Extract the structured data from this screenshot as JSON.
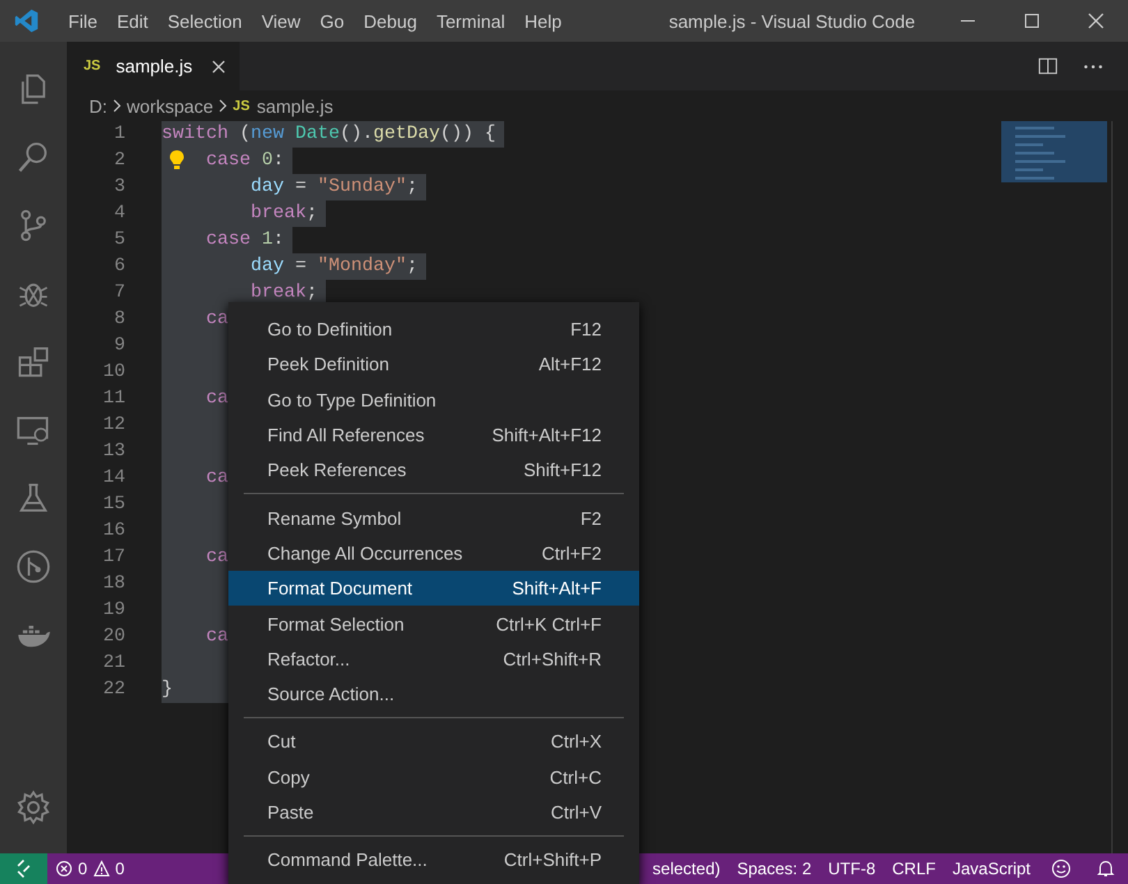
{
  "window": {
    "title": "sample.js - Visual Studio Code"
  },
  "menu_bar": [
    "File",
    "Edit",
    "Selection",
    "View",
    "Go",
    "Debug",
    "Terminal",
    "Help"
  ],
  "tabs": [
    {
      "badge": "JS",
      "label": "sample.js",
      "selected": true
    }
  ],
  "breadcrumb": [
    {
      "label": "D:"
    },
    {
      "label": "workspace"
    },
    {
      "badge": "JS",
      "label": "sample.js"
    }
  ],
  "code_lines": [
    {
      "number": "1",
      "selected": true,
      "tokens": [
        {
          "kind": "keyword",
          "text": "switch"
        },
        {
          "kind": "plain",
          "text": " ("
        },
        {
          "kind": "storage",
          "text": "new"
        },
        {
          "kind": "type",
          "text": " Date"
        },
        {
          "kind": "plain",
          "text": "()."
        },
        {
          "kind": "function",
          "text": "getDay"
        },
        {
          "kind": "plain",
          "text": "()) {"
        }
      ]
    },
    {
      "number": "2",
      "selected": true,
      "bulb": true,
      "tokens": [
        {
          "kind": "keyword",
          "text": "    case"
        },
        {
          "kind": "number",
          "text": " 0"
        },
        {
          "kind": "plain",
          "text": ":"
        }
      ]
    },
    {
      "number": "3",
      "selected": true,
      "tokens": [
        {
          "kind": "variable",
          "text": "        day"
        },
        {
          "kind": "plain",
          "text": " = "
        },
        {
          "kind": "string",
          "text": "\"Sunday\""
        },
        {
          "kind": "plain",
          "text": ";"
        }
      ]
    },
    {
      "number": "4",
      "selected": true,
      "tokens": [
        {
          "kind": "keyword",
          "text": "        break"
        },
        {
          "kind": "plain",
          "text": ";"
        }
      ]
    },
    {
      "number": "5",
      "selected": true,
      "tokens": [
        {
          "kind": "keyword",
          "text": "    case"
        },
        {
          "kind": "number",
          "text": " 1"
        },
        {
          "kind": "plain",
          "text": ":"
        }
      ]
    },
    {
      "number": "6",
      "selected": true,
      "tokens": [
        {
          "kind": "variable",
          "text": "        day"
        },
        {
          "kind": "plain",
          "text": " = "
        },
        {
          "kind": "string",
          "text": "\"Monday\""
        },
        {
          "kind": "plain",
          "text": ";"
        }
      ]
    },
    {
      "number": "7",
      "selected": true,
      "tokens": [
        {
          "kind": "keyword",
          "text": "        break"
        },
        {
          "kind": "plain",
          "text": ";"
        }
      ]
    },
    {
      "number": "8",
      "selected": true,
      "tokens": [
        {
          "kind": "keyword",
          "text": "    ca"
        }
      ]
    },
    {
      "number": "9",
      "selected": true
    },
    {
      "number": "10",
      "selected": true
    },
    {
      "number": "11",
      "selected": true,
      "tokens": [
        {
          "kind": "keyword",
          "text": "    ca"
        }
      ]
    },
    {
      "number": "12",
      "selected": true
    },
    {
      "number": "13",
      "selected": true
    },
    {
      "number": "14",
      "selected": true,
      "tokens": [
        {
          "kind": "keyword",
          "text": "    ca"
        }
      ]
    },
    {
      "number": "15",
      "selected": true
    },
    {
      "number": "16",
      "selected": true
    },
    {
      "number": "17",
      "selected": true,
      "tokens": [
        {
          "kind": "keyword",
          "text": "    ca"
        }
      ]
    },
    {
      "number": "18",
      "selected": true
    },
    {
      "number": "19",
      "selected": true
    },
    {
      "number": "20",
      "selected": true,
      "tokens": [
        {
          "kind": "keyword",
          "text": "    ca"
        }
      ]
    },
    {
      "number": "21",
      "selected": true
    },
    {
      "number": "22",
      "selected": true,
      "tokens": [
        {
          "kind": "plain",
          "text": "}"
        }
      ]
    }
  ],
  "context_menu": [
    [
      {
        "label": "Go to Definition",
        "shortcut": "F12",
        "selected": false
      },
      {
        "label": "Peek Definition",
        "shortcut": "Alt+F12",
        "selected": false
      },
      {
        "label": "Go to Type Definition",
        "selected": false
      },
      {
        "label": "Find All References",
        "shortcut": "Shift+Alt+F12",
        "selected": false
      },
      {
        "label": "Peek References",
        "shortcut": "Shift+F12",
        "selected": false
      }
    ],
    [
      {
        "label": "Rename Symbol",
        "shortcut": "F2",
        "selected": false
      },
      {
        "label": "Change All Occurrences",
        "shortcut": "Ctrl+F2",
        "selected": false
      },
      {
        "label": "Format Document",
        "shortcut": "Shift+Alt+F",
        "selected": true
      },
      {
        "label": "Format Selection",
        "shortcut": "Ctrl+K Ctrl+F",
        "selected": false
      },
      {
        "label": "Refactor...",
        "shortcut": "Ctrl+Shift+R",
        "selected": false
      },
      {
        "label": "Source Action...",
        "selected": false
      }
    ],
    [
      {
        "label": "Cut",
        "shortcut": "Ctrl+X",
        "selected": false
      },
      {
        "label": "Copy",
        "shortcut": "Ctrl+C",
        "selected": false
      },
      {
        "label": "Paste",
        "shortcut": "Ctrl+V",
        "selected": false
      }
    ],
    [
      {
        "label": "Command Palette...",
        "shortcut": "Ctrl+Shift+P",
        "selected": false
      }
    ]
  ],
  "status_bar": {
    "errors": "0",
    "warnings": "0",
    "right": [
      "selected)",
      "Spaces: 2",
      "UTF-8",
      "CRLF",
      "JavaScript"
    ]
  }
}
